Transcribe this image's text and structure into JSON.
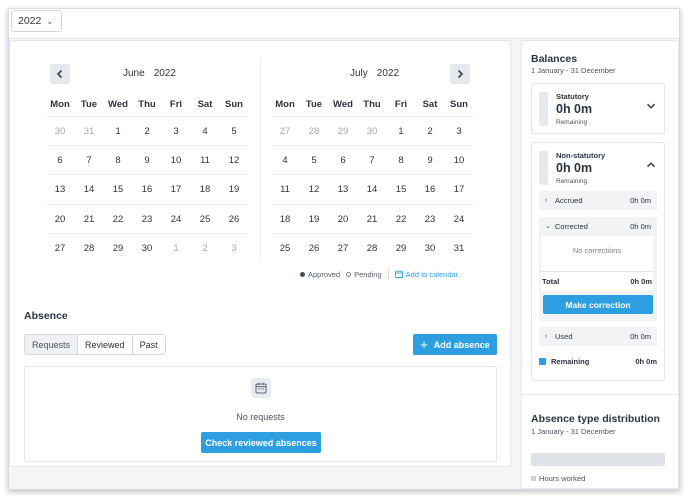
{
  "topbar": {
    "year": "2022"
  },
  "calendar": {
    "weekdays": [
      "Mon",
      "Tue",
      "Wed",
      "Thu",
      "Fri",
      "Sat",
      "Sun"
    ],
    "months": [
      {
        "name": "June",
        "year": "2022",
        "weeks": [
          [
            [
              "30",
              1
            ],
            [
              "31",
              1
            ],
            [
              "1",
              0
            ],
            [
              "2",
              0
            ],
            [
              "3",
              0
            ],
            [
              "4",
              0
            ],
            [
              "5",
              0
            ]
          ],
          [
            [
              "6",
              0
            ],
            [
              "7",
              0
            ],
            [
              "8",
              0
            ],
            [
              "9",
              0
            ],
            [
              "10",
              0
            ],
            [
              "11",
              0
            ],
            [
              "12",
              0
            ]
          ],
          [
            [
              "13",
              0
            ],
            [
              "14",
              0
            ],
            [
              "15",
              0
            ],
            [
              "16",
              0
            ],
            [
              "17",
              0
            ],
            [
              "18",
              0
            ],
            [
              "19",
              0
            ]
          ],
          [
            [
              "20",
              0
            ],
            [
              "21",
              0
            ],
            [
              "22",
              0
            ],
            [
              "23",
              0
            ],
            [
              "24",
              0
            ],
            [
              "25",
              0
            ],
            [
              "26",
              0
            ]
          ],
          [
            [
              "27",
              0
            ],
            [
              "28",
              0
            ],
            [
              "29",
              0
            ],
            [
              "30",
              0
            ],
            [
              "1",
              1
            ],
            [
              "2",
              1
            ],
            [
              "3",
              1
            ]
          ]
        ]
      },
      {
        "name": "July",
        "year": "2022",
        "weeks": [
          [
            [
              "27",
              1
            ],
            [
              "28",
              1
            ],
            [
              "29",
              1
            ],
            [
              "30",
              1
            ],
            [
              "1",
              0
            ],
            [
              "2",
              0
            ],
            [
              "3",
              0
            ]
          ],
          [
            [
              "4",
              0
            ],
            [
              "5",
              0
            ],
            [
              "6",
              0
            ],
            [
              "7",
              0
            ],
            [
              "8",
              0
            ],
            [
              "9",
              0
            ],
            [
              "10",
              0
            ]
          ],
          [
            [
              "11",
              0
            ],
            [
              "12",
              0
            ],
            [
              "13",
              0
            ],
            [
              "14",
              0
            ],
            [
              "15",
              0
            ],
            [
              "16",
              0
            ],
            [
              "17",
              0
            ]
          ],
          [
            [
              "18",
              0
            ],
            [
              "19",
              0
            ],
            [
              "20",
              0
            ],
            [
              "21",
              0
            ],
            [
              "22",
              0
            ],
            [
              "23",
              0
            ],
            [
              "24",
              0
            ]
          ],
          [
            [
              "25",
              0
            ],
            [
              "26",
              0
            ],
            [
              "27",
              0
            ],
            [
              "28",
              0
            ],
            [
              "29",
              0
            ],
            [
              "30",
              0
            ],
            [
              "31",
              0
            ]
          ]
        ]
      }
    ],
    "legend": {
      "approved": "Approved",
      "pending": "Pending",
      "add_to_calendar": "Add to calendar"
    }
  },
  "absence": {
    "title": "Absence",
    "tabs": [
      "Requests",
      "Reviewed",
      "Past"
    ],
    "add_button": "Add absence",
    "empty_text": "No requests",
    "check_button": "Check reviewed absences"
  },
  "balances": {
    "title": "Balances",
    "period": "1 January - 31 December",
    "statutory": {
      "label": "Statutory",
      "value": "0h 0m",
      "remaining": "Remaining"
    },
    "non_statutory": {
      "label": "Non-statutory",
      "value": "0h 0m",
      "remaining": "Remaining",
      "accrued": {
        "label": "Accrued",
        "value": "0h 0m"
      },
      "corrected": {
        "label": "Corrected",
        "value": "0h 0m",
        "empty": "No corrections",
        "total_label": "Total",
        "total_value": "0h 0m"
      },
      "make_correction": "Make correction",
      "used": {
        "label": "Used",
        "value": "0h 0m"
      },
      "remaining_row": {
        "label": "Remaining",
        "value": "0h 0m"
      }
    }
  },
  "distribution": {
    "title": "Absence type distribution",
    "period": "1 January - 31 December",
    "legend": "Hours worked"
  },
  "colors": {
    "accent": "#2d9fe0",
    "muted_day": "#a3a9b1",
    "text": "#2c3440"
  }
}
